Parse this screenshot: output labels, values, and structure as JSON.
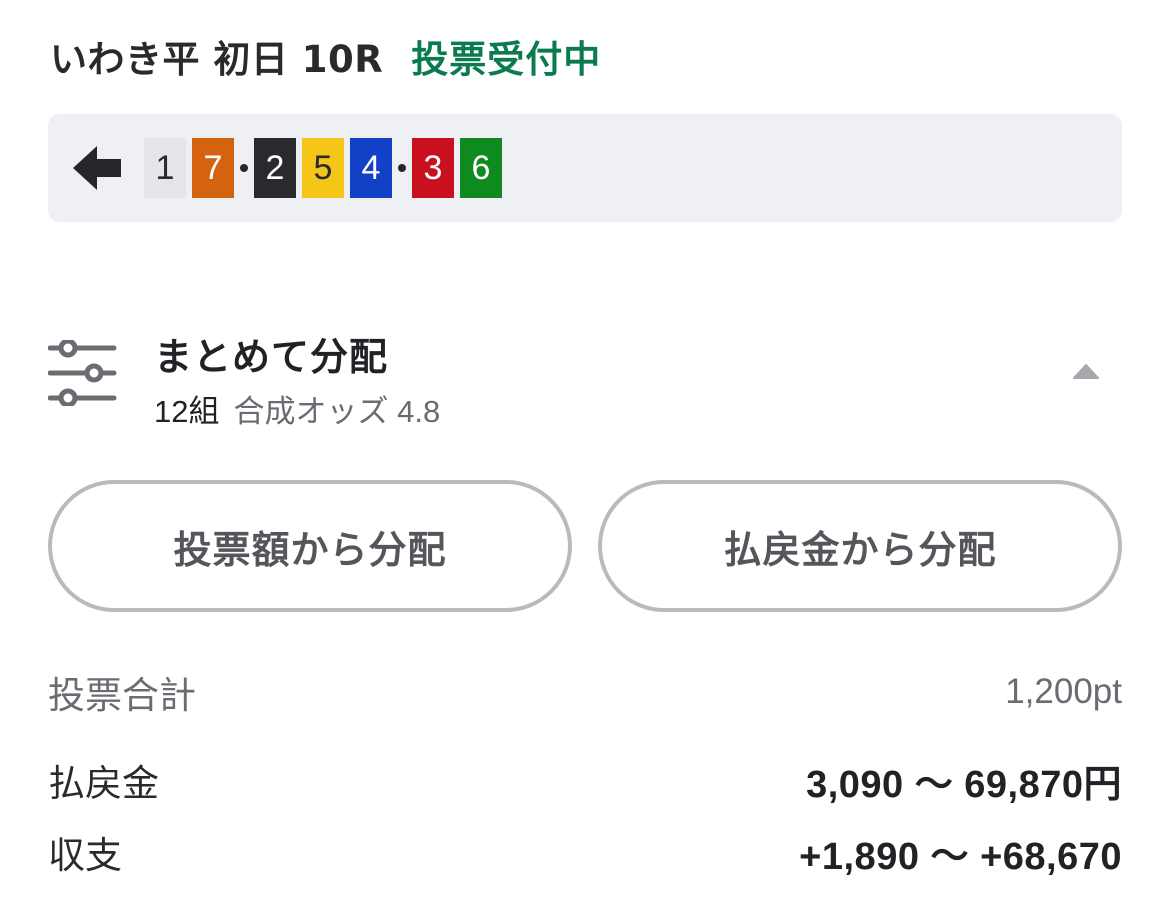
{
  "header": {
    "race_title": "いわき平 初日 10R",
    "status": "投票受付中",
    "status_color": "#0b7a4f"
  },
  "combination": {
    "back_icon": "arrow-left-icon",
    "groups": [
      [
        {
          "num": "1",
          "bg": "#e3e5e8",
          "fg": "#2a2a2e"
        },
        {
          "num": "7",
          "bg": "#d4620e",
          "fg": "#ffffff"
        }
      ],
      [
        {
          "num": "2",
          "bg": "#2a2a2e",
          "fg": "#ffffff"
        },
        {
          "num": "5",
          "bg": "#f5c518",
          "fg": "#2a2a2e"
        },
        {
          "num": "4",
          "bg": "#1241c8",
          "fg": "#ffffff"
        }
      ],
      [
        {
          "num": "3",
          "bg": "#c8101e",
          "fg": "#ffffff"
        },
        {
          "num": "6",
          "bg": "#0e8a1e",
          "fg": "#ffffff"
        }
      ]
    ]
  },
  "distribution": {
    "icon": "sliders-icon",
    "title": "まとめて分配",
    "count": "12組",
    "odds": "合成オッズ 4.8",
    "collapse_icon": "caret-up-icon"
  },
  "buttons": {
    "by_bet": "投票額から分配",
    "by_payout": "払戻金から分配"
  },
  "summary": {
    "total_label": "投票合計",
    "total_value": "1,200pt",
    "payout_label": "払戻金",
    "payout_value": "3,090 〜 69,870円",
    "balance_label": "収支",
    "balance_value": "+1,890 〜 +68,670"
  }
}
